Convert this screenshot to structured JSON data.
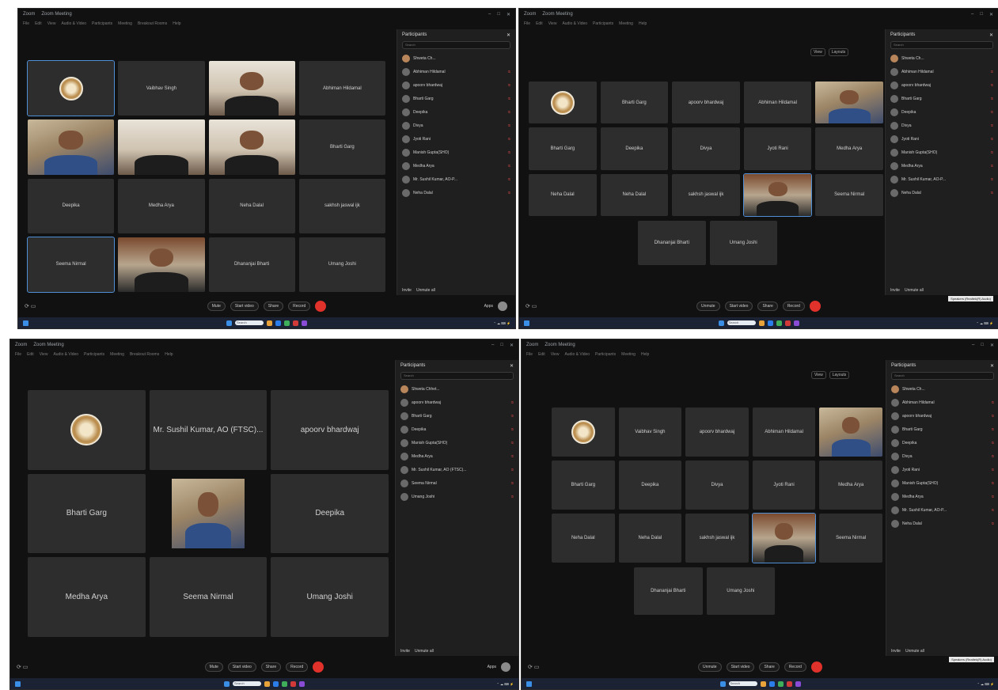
{
  "window": {
    "app": "Zoom",
    "title": "Zoom Meeting"
  },
  "menu": [
    "File",
    "Edit",
    "View",
    "Audio & Video",
    "Participants",
    "Meeting",
    "Breakout Rooms",
    "Help"
  ],
  "panel_title": "Participants",
  "search_placeholder": "Search",
  "panel_footer": {
    "invite": "Invite",
    "mute_all": "Unmute all"
  },
  "toolbar": {
    "mute": "Mute",
    "unmute": "Unmute",
    "start_video": "Start video",
    "share": "Share",
    "record": "Record",
    "apps": "Apps"
  },
  "top_controls": {
    "view": "View",
    "layouts": "Layouts"
  },
  "tooltip": "Speakers (Realtek(R) Audio)",
  "colors": {
    "panel_bg": "#1f1f1f",
    "tile_bg": "#2d2d2d",
    "end_button": "#e0312b",
    "active_outline": "#4f8fd6",
    "taskbar": "#1a2233"
  },
  "q1": {
    "tiles": [
      {
        "name": "logo",
        "caption": ""
      },
      {
        "name": "Vaibhav Singh"
      },
      {
        "name": "video"
      },
      {
        "name": "Abhiman Hildamal"
      },
      {
        "name": "video"
      },
      {
        "name": "video"
      },
      {
        "name": "video"
      },
      {
        "name": "Bharti Garg"
      },
      {
        "name": "Deepika"
      },
      {
        "name": "Medha Arya"
      },
      {
        "name": "Neha Dalal"
      },
      {
        "name": "sakhsh jaswal ijk"
      },
      {
        "name": "Seema Nirmal"
      },
      {
        "name": "video"
      },
      {
        "name": "Dhananjai Bharti"
      },
      {
        "name": "Umang Joshi"
      }
    ],
    "participants": [
      {
        "name": "Shweta Ch...",
        "me": true
      },
      {
        "name": "Abhiman Hildamal"
      },
      {
        "name": "apoorv bhardwaj"
      },
      {
        "name": "Bharti Garg"
      },
      {
        "name": "Deepika"
      },
      {
        "name": "Divya"
      },
      {
        "name": "Jyoti Rani"
      },
      {
        "name": "Manish Gupta(SHO)"
      },
      {
        "name": "Medha Arya"
      },
      {
        "name": "Mr. Sushil Kumar, AO-P..."
      },
      {
        "name": "Neha Dalal"
      }
    ]
  },
  "q2": {
    "tiles": [
      {
        "name": "logo"
      },
      {
        "name": "Bharti Garg"
      },
      {
        "name": "apoorv bhardwaj"
      },
      {
        "name": "Abhiman Hildamal"
      },
      {
        "name": "video"
      },
      {
        "name": "Bharti Garg"
      },
      {
        "name": "Deepika"
      },
      {
        "name": "Divya"
      },
      {
        "name": "Jyoti Rani"
      },
      {
        "name": "Medha Arya"
      },
      {
        "name": "Neha Dalal"
      },
      {
        "name": "Neha Dalal"
      },
      {
        "name": "sakhsh jaswal ijk"
      },
      {
        "name": "video"
      },
      {
        "name": "Seema Nirmal"
      },
      {
        "name": "Dhananjai Bharti"
      },
      {
        "name": "Umang Joshi"
      }
    ],
    "participants": [
      {
        "name": "Shweta Ch...",
        "me": true
      },
      {
        "name": "Abhiman Hildamal"
      },
      {
        "name": "apoorv bhardwaj"
      },
      {
        "name": "Bharti Garg"
      },
      {
        "name": "Deepika"
      },
      {
        "name": "Divya"
      },
      {
        "name": "Jyoti Rani"
      },
      {
        "name": "Manish Gupta(SHO)"
      },
      {
        "name": "Medha Arya"
      },
      {
        "name": "Mr. Sushil Kumar, AO-P..."
      },
      {
        "name": "Neha Dalal"
      }
    ]
  },
  "q3": {
    "tiles": [
      {
        "name": "logo"
      },
      {
        "name": "Mr. Sushil Kumar, AO (FTSC)..."
      },
      {
        "name": "apoorv bhardwaj"
      },
      {
        "name": "Bharti Garg"
      },
      {
        "name": "video"
      },
      {
        "name": "Deepika"
      },
      {
        "name": "Medha Arya"
      },
      {
        "name": "Seema Nirmal"
      },
      {
        "name": "Umang Joshi"
      }
    ],
    "participants": [
      {
        "name": "Shweta Chhet...",
        "me": true
      },
      {
        "name": "apoorv bhardwaj"
      },
      {
        "name": "Bharti Garg"
      },
      {
        "name": "Deepika"
      },
      {
        "name": "Manish Gupta(SHO)"
      },
      {
        "name": "Medha Arya"
      },
      {
        "name": "Mr. Sushil Kumar, AO (FTSC)..."
      },
      {
        "name": "Seema Nirmal"
      },
      {
        "name": "Umang Joshi"
      }
    ]
  },
  "q4": {
    "tiles": [
      {
        "name": "logo"
      },
      {
        "name": "Vaibhav Singh"
      },
      {
        "name": "apoorv bhardwaj"
      },
      {
        "name": "Abhiman Hildamal"
      },
      {
        "name": "video"
      },
      {
        "name": "Bharti Garg"
      },
      {
        "name": "Deepika"
      },
      {
        "name": "Divya"
      },
      {
        "name": "Jyoti Rani"
      },
      {
        "name": "Medha Arya"
      },
      {
        "name": "Neha Dalal"
      },
      {
        "name": "Neha Dalal"
      },
      {
        "name": "sakhsh jaswal ijk"
      },
      {
        "name": "video"
      },
      {
        "name": "Seema Nirmal"
      },
      {
        "name": "Dhananjai Bharti"
      },
      {
        "name": "Umang Joshi"
      }
    ],
    "participants": [
      {
        "name": "Shweta Ch...",
        "me": true
      },
      {
        "name": "Abhiman Hildamal"
      },
      {
        "name": "apoorv bhardwaj"
      },
      {
        "name": "Bharti Garg"
      },
      {
        "name": "Deepika"
      },
      {
        "name": "Divya"
      },
      {
        "name": "Jyoti Rani"
      },
      {
        "name": "Manish Gupta(SHO)"
      },
      {
        "name": "Medha Arya"
      },
      {
        "name": "Mr. Sushil Kumar, AO-P..."
      },
      {
        "name": "Neha Dalal"
      }
    ]
  }
}
